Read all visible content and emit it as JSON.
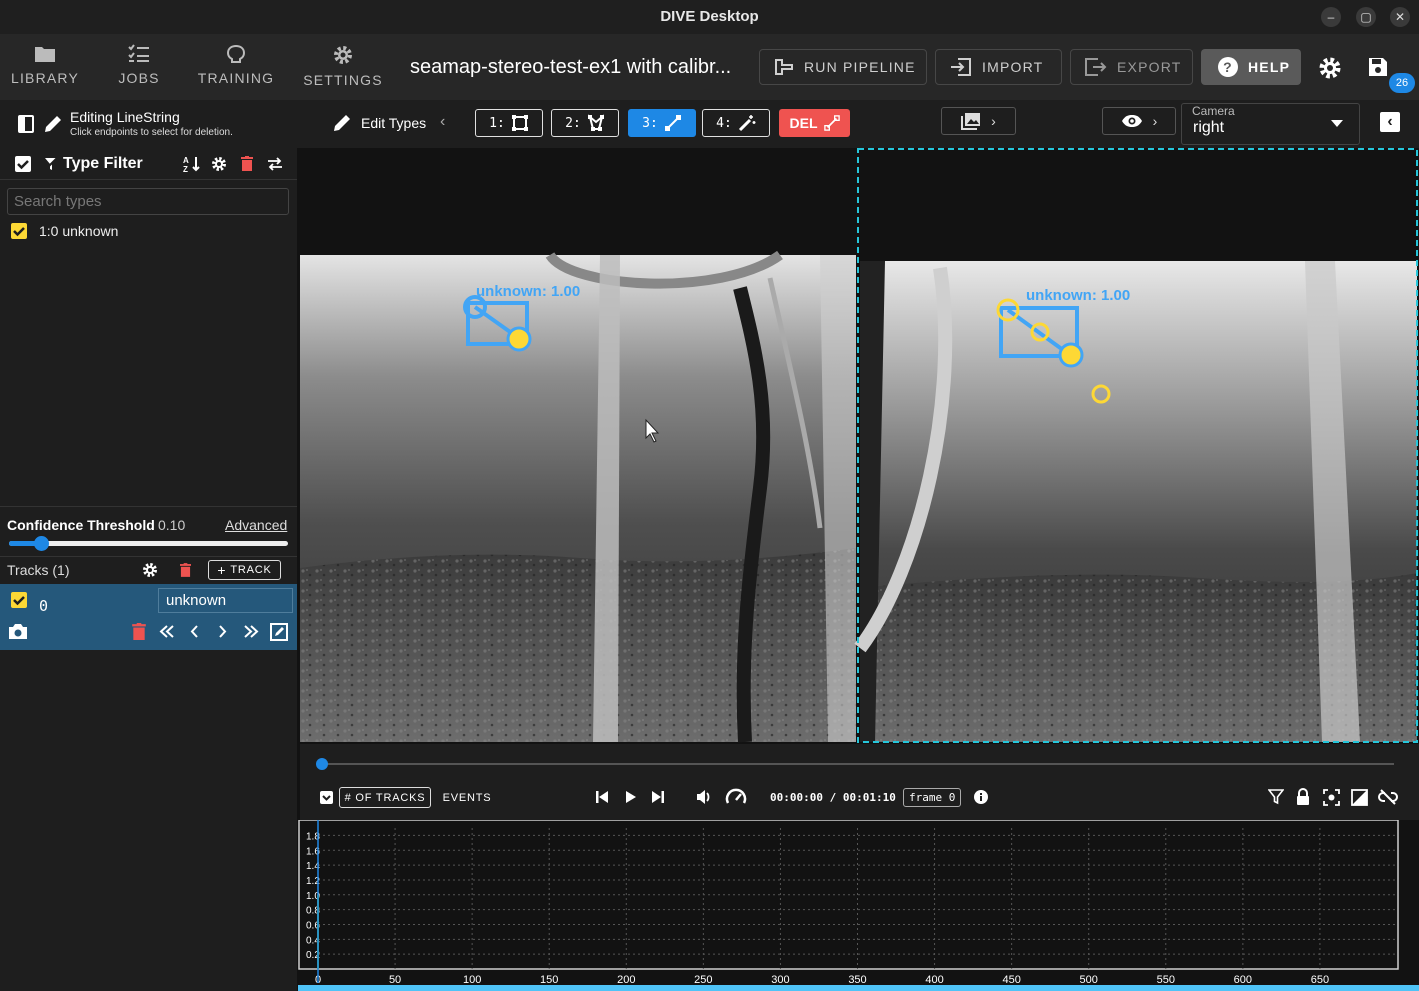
{
  "window": {
    "title": "DIVE Desktop"
  },
  "nav": {
    "library": "LIBRARY",
    "jobs": "JOBS",
    "training": "TRAINING",
    "settings": "SETTINGS"
  },
  "dataset_title": "seamap-stereo-test-ex1 with calibr...",
  "toolbar": {
    "run_pipeline": "RUN PIPELINE",
    "import": "IMPORT",
    "export": "EXPORT",
    "help": "HELP",
    "save_badge": "26"
  },
  "edit": {
    "title": "Editing LineString",
    "subtitle": "Click endpoints to select for deletion.",
    "types_label": "Edit Types",
    "modes": [
      "1:",
      "2:",
      "3:",
      "4:"
    ],
    "active_mode": 3,
    "delete": "DEL"
  },
  "camera": {
    "label": "Camera",
    "value": "right"
  },
  "type_filter": {
    "title": "Type Filter",
    "search_placeholder": "Search types",
    "items": [
      {
        "label": "1:0 unknown",
        "checked": true
      }
    ]
  },
  "confidence": {
    "label": "Confidence Threshold",
    "value": "0.10",
    "fraction": 0.1,
    "advanced": "Advanced"
  },
  "tracks": {
    "label": "Tracks (1)",
    "add_button": "TRACK",
    "rows": [
      {
        "id": "0",
        "type": "unknown",
        "checked": true
      }
    ]
  },
  "annotations": {
    "left": "unknown: 1.00",
    "right": "unknown: 1.00"
  },
  "timeline": {
    "tracks_chip": "# OF TRACKS",
    "events_chip": "EVENTS",
    "time": "00:00:00 / 00:01:10",
    "frame": "frame 0"
  },
  "chart_data": {
    "type": "line",
    "xlabel": "",
    "ylabel": "",
    "x_ticks": [
      0,
      50,
      100,
      150,
      200,
      250,
      300,
      350,
      400,
      450,
      500,
      550,
      600,
      650
    ],
    "y_ticks": [
      "0.2",
      "0.4",
      "0.6",
      "0.8",
      "1.0",
      "1.2",
      "1.4",
      "1.6",
      "1.8"
    ],
    "xlim": [
      0,
      700
    ],
    "ylim": [
      0,
      1.9
    ],
    "series": [
      {
        "values": [
          [
            0,
            1
          ]
        ]
      }
    ],
    "grid": true
  },
  "colors": {
    "accent": "#1e88e5",
    "annotation": "#42a5f5",
    "handle": "#fdd835",
    "delete": "#ef5350",
    "selection": "#26c6da"
  }
}
